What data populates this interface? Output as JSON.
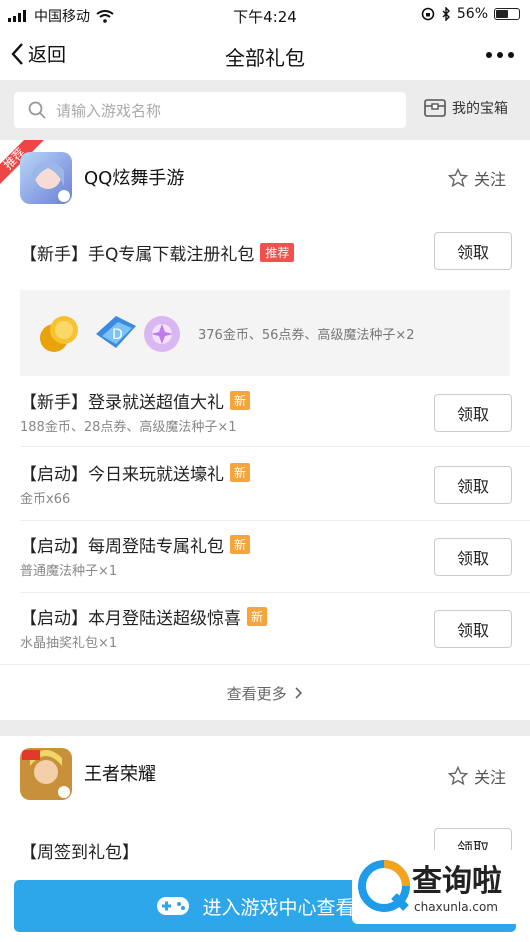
{
  "status": {
    "carrier": "中国移动",
    "time": "下午4:24",
    "battery": "56%",
    "battery_level": 0.56
  },
  "nav": {
    "back_label": "返回",
    "title": "全部礼包"
  },
  "search": {
    "placeholder": "请输入游戏名称",
    "treasure_label": "我的宝箱"
  },
  "game1": {
    "corner_badge": "推荐",
    "name": "QQ炫舞手游",
    "follow_label": "关注",
    "gifts": [
      {
        "title": "【新手】手Q专属下载注册礼包",
        "badge": "推荐",
        "subtitle": "",
        "button": "领取"
      },
      {
        "title": "【新手】登录就送超值大礼",
        "badge": "新",
        "subtitle": "188金币、28点券、高级魔法种子×1",
        "button": "领取"
      },
      {
        "title": "【启动】今日来玩就送壕礼",
        "badge": "新",
        "subtitle": "金币x66",
        "button": "领取"
      },
      {
        "title": "【启动】每周登陆专属礼包",
        "badge": "新",
        "subtitle": "普通魔法种子×1",
        "button": "领取"
      },
      {
        "title": "【启动】本月登陆送超级惊喜",
        "badge": "新",
        "subtitle": "水晶抽奖礼包×1",
        "button": "领取"
      }
    ],
    "prize_text": "376金币、56点券、高级魔法种子×2",
    "see_more": "查看更多"
  },
  "game2": {
    "name": "王者荣耀",
    "follow_label": "关注",
    "gift_title": "【周签到礼包】",
    "button": "领取"
  },
  "bottom": {
    "label": "进入游戏中心查看更"
  },
  "watermark": {
    "title": "查询啦",
    "domain": "chaxunla.com"
  }
}
